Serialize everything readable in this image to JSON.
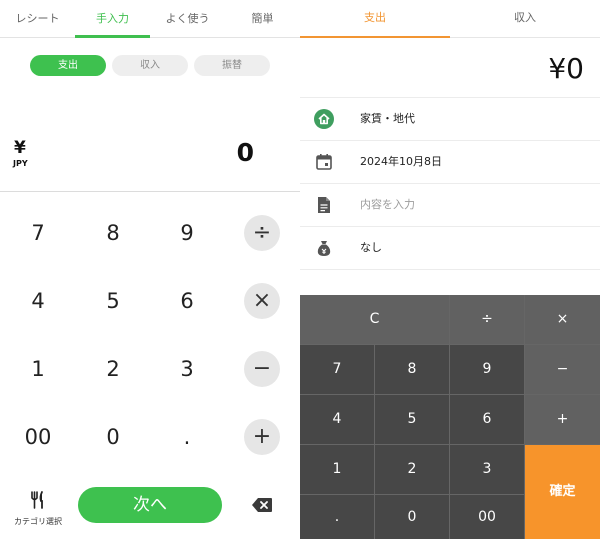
{
  "left": {
    "tabs": [
      "レシート",
      "手入力",
      "よく使う",
      "簡単"
    ],
    "active_tab": 1,
    "segments": [
      "支出",
      "収入",
      "振替"
    ],
    "currency_symbol": "¥",
    "currency_code": "JPY",
    "amount": "0",
    "keys": [
      [
        "7",
        "8",
        "9"
      ],
      [
        "4",
        "5",
        "6"
      ],
      [
        "1",
        "2",
        "3"
      ],
      [
        "00",
        "0",
        "."
      ]
    ],
    "op_keys": [
      "÷",
      "×",
      "−",
      "+"
    ],
    "category_label": "カテゴリ選択",
    "next_label": "次へ",
    "accent_color": "#3ec14f"
  },
  "right": {
    "tabs": [
      "支出",
      "収入"
    ],
    "active_tab": 0,
    "amount": "¥0",
    "rows": [
      {
        "icon": "house-icon",
        "text": "家賃・地代",
        "placeholder": false
      },
      {
        "icon": "calendar-icon",
        "text": "2024年10月8日",
        "placeholder": false
      },
      {
        "icon": "document-icon",
        "text": "内容を入力",
        "placeholder": true
      },
      {
        "icon": "money-bag-icon",
        "text": "なし",
        "placeholder": false
      }
    ],
    "calculator": {
      "clear": "C",
      "divide": "÷",
      "multiply": "×",
      "minus": "−",
      "plus": "+",
      "confirm": "確定",
      "digits": [
        [
          "7",
          "8",
          "9"
        ],
        [
          "4",
          "5",
          "6"
        ],
        [
          "1",
          "2",
          "3"
        ],
        [
          ".",
          "0",
          "00"
        ]
      ]
    },
    "accent_color": "#f29532",
    "confirm_color": "#f7942b"
  }
}
